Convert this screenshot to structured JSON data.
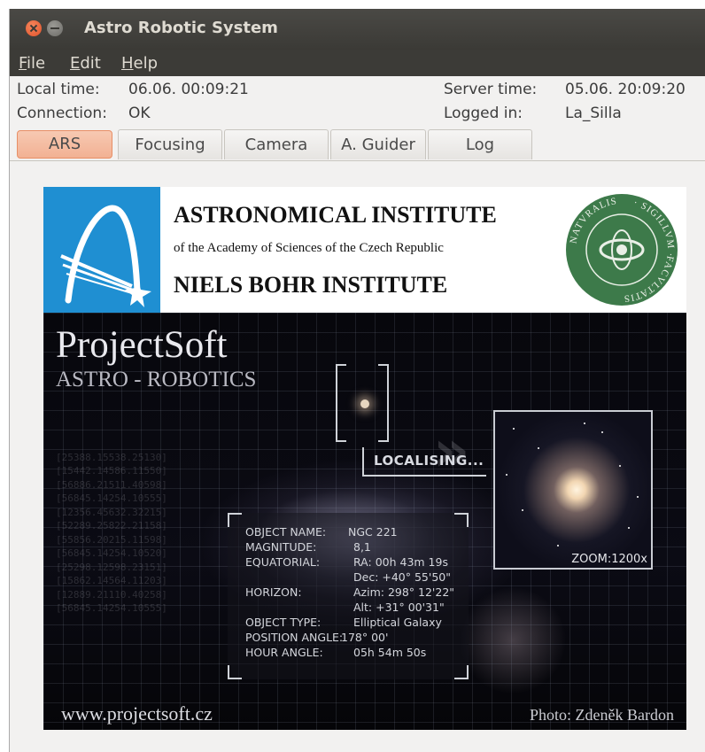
{
  "window": {
    "title": "Astro Robotic System"
  },
  "menu": {
    "file": {
      "accel": "F",
      "rest": "ile"
    },
    "edit": {
      "accel": "E",
      "rest": "dit"
    },
    "help": {
      "accel": "H",
      "rest": "elp"
    }
  },
  "status": {
    "local_time_label": "Local time:",
    "local_time_value": "06.06. 00:09:21",
    "server_time_label": "Server time:",
    "server_time_value": "05.06. 20:09:20",
    "connection_label": "Connection:",
    "connection_value": "OK",
    "logged_in_label": "Logged in:",
    "logged_in_value": "La_Silla"
  },
  "tabs": [
    {
      "label": "ARS",
      "active": true
    },
    {
      "label": "Focusing",
      "active": false
    },
    {
      "label": "Camera",
      "active": false
    },
    {
      "label": "A. Guider",
      "active": false
    },
    {
      "label": "Log",
      "active": false
    }
  ],
  "splash": {
    "institute_line1": "ASTRONOMICAL INSTITUTE",
    "institute_line2": "of the Academy of Sciences of the Czech Republic",
    "institute_line3": "NIELS BOHR INSTITUTE",
    "seal_text_top": "· SIGILLVM ·",
    "seal_text_right": "FACVLTATIS",
    "seal_text_left": "NATVRALIS",
    "brand_title": "ProjectSoft",
    "brand_subtitle": "ASTRO - ROBOTICS",
    "localising_label": "LOCALISING...",
    "zoom_label": "ZOOM:1200x",
    "object": {
      "name_label": "OBJECT NAME:",
      "name_value": "NGC 221",
      "magnitude_label": "MAGNITUDE:",
      "magnitude_value": "8,1",
      "equatorial_label": "EQUATORIAL:",
      "ra_value": "RA: 00h 43m 19s",
      "dec_value": "Dec: +40° 55'50\"",
      "horizon_label": "HORIZON:",
      "azim_value": "Azim: 298° 12'22\"",
      "alt_value": "Alt: +31° 00'31\"",
      "type_label": "OBJECT TYPE:",
      "type_value": "Elliptical Galaxy",
      "position_angle_label": "POSITION ANGLE:",
      "position_angle_value": "178° 00'",
      "hour_angle_label": "HOUR ANGLE:",
      "hour_angle_value": "05h 54m 50s"
    },
    "url": "www.projectsoft.cz",
    "photo_credit": "Photo: Zdeněk Bardon"
  },
  "colors": {
    "active_tab": "#f2b193",
    "logo_blue": "#1f8fd2",
    "seal_green": "#3d7a4a",
    "titlebar": "#3c3b37"
  }
}
